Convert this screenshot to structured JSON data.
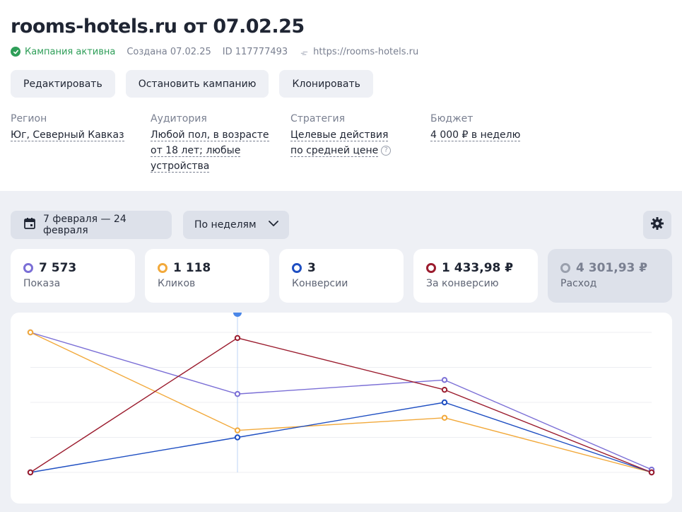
{
  "header": {
    "title": "rooms-hotels.ru от 07.02.25",
    "status": "Кампания активна",
    "created": "Создана 07.02.25",
    "id": "ID 117777493",
    "url": "https://rooms-hotels.ru"
  },
  "actions": {
    "edit": "Редактировать",
    "stop": "Остановить кампанию",
    "clone": "Клонировать"
  },
  "params": {
    "region_label": "Регион",
    "region_value": "Юг, Северный Кавказ",
    "audience_label": "Аудитория",
    "audience_line1": "Любой пол, в возрасте",
    "audience_line2": "от 18 лет; любые",
    "audience_line3": "устройства",
    "strategy_label": "Стратегия",
    "strategy_line1": "Целевые действия",
    "strategy_line2": "по средней цене",
    "budget_label": "Бюджет",
    "budget_value": "4 000 ₽ в неделю"
  },
  "toolbar": {
    "date_range": "7 февраля — 24 февраля",
    "period": "По неделям"
  },
  "metrics": [
    {
      "value": "7 573",
      "label": "Показа",
      "color": "#7b6fd6"
    },
    {
      "value": "1 118",
      "label": "Кликов",
      "color": "#f2a93b"
    },
    {
      "value": "3",
      "label": "Конверсии",
      "color": "#1f4fc2"
    },
    {
      "value": "1 433,98 ₽",
      "label": "За конверсию",
      "color": "#9b1c2e"
    },
    {
      "value": "4 301,93 ₽",
      "label": "Расход",
      "color": "#9aa0ad"
    }
  ],
  "chart_data": {
    "type": "line",
    "x": [
      1,
      2,
      3,
      4
    ],
    "ylim": [
      0,
      1
    ],
    "grid": true,
    "series": [
      {
        "color": "#7b6fd6",
        "values": [
          1.0,
          0.56,
          0.66,
          0.02
        ]
      },
      {
        "color": "#f2a93b",
        "values": [
          1.0,
          0.3,
          0.39,
          0.0
        ]
      },
      {
        "color": "#1f4fc2",
        "values": [
          0.0,
          0.25,
          0.5,
          0.0
        ]
      },
      {
        "color": "#9b1c2e",
        "values": [
          0.0,
          0.96,
          0.59,
          0.0
        ]
      }
    ],
    "highlight_index": 1
  }
}
